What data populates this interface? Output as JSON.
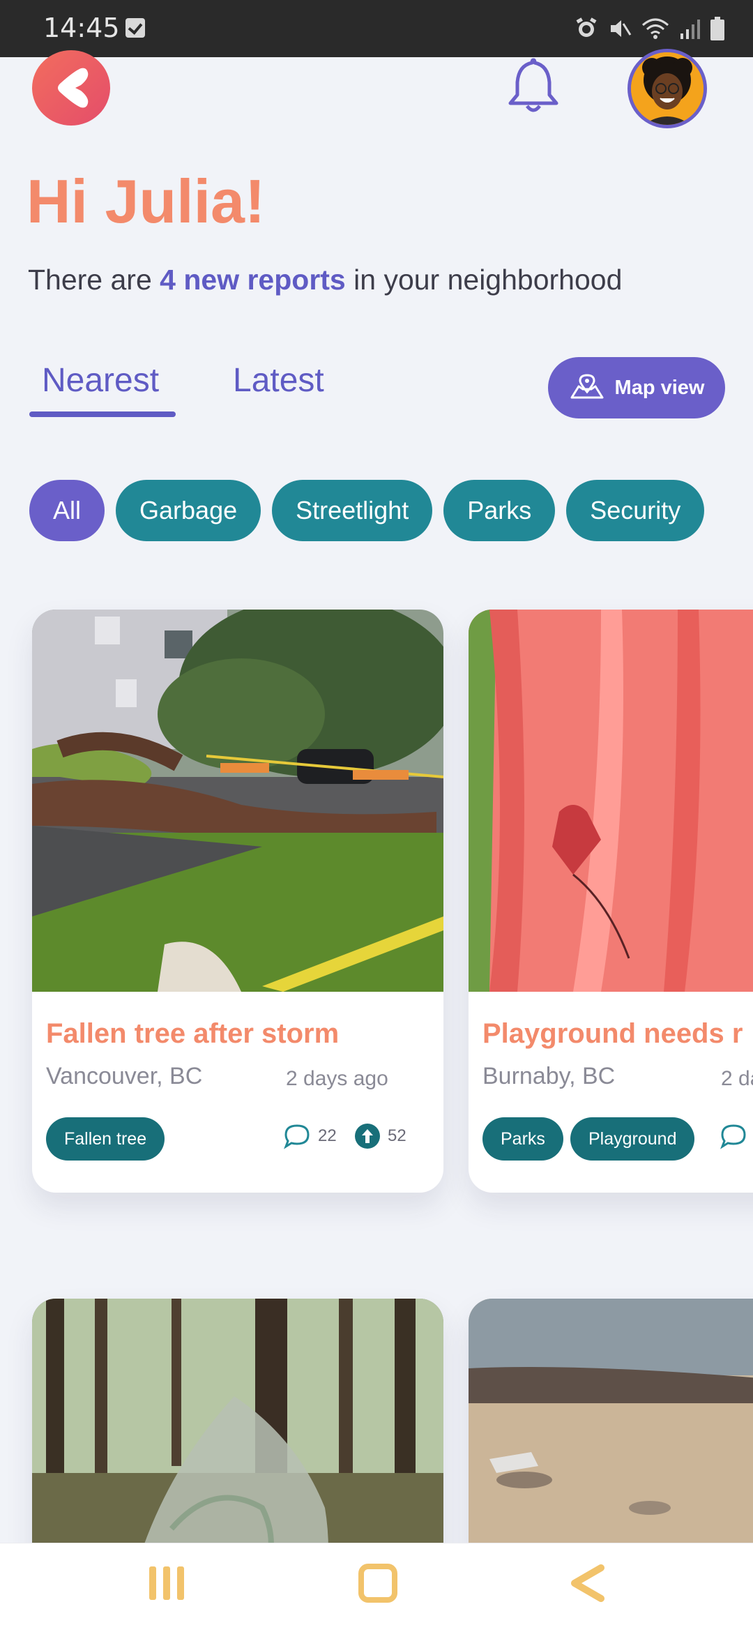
{
  "status_bar": {
    "time": "14:45"
  },
  "header": {
    "greeting": "Hi Julia!",
    "subline_prefix": "There are ",
    "subline_highlight": "4 new reports",
    "subline_suffix": " in your neighborhood"
  },
  "tabs": [
    {
      "label": "Nearest",
      "active": true
    },
    {
      "label": "Latest",
      "active": false
    }
  ],
  "map_button": {
    "label": "Map view"
  },
  "filters": [
    {
      "label": "All",
      "active": true
    },
    {
      "label": "Garbage",
      "active": false
    },
    {
      "label": "Streetlight",
      "active": false
    },
    {
      "label": "Parks",
      "active": false
    },
    {
      "label": "Security",
      "active": false
    }
  ],
  "reports": [
    {
      "title": "Fallen tree after storm",
      "location": "Vancouver, BC",
      "time": "2 days ago",
      "tags": [
        "Fallen tree"
      ],
      "comments": "22",
      "upvotes": "52"
    },
    {
      "title": "Playground needs r",
      "location": "Burnaby, BC",
      "time": "2 da",
      "tags": [
        "Parks",
        "Playground"
      ]
    }
  ],
  "colors": {
    "accent_purple": "#6a5fc9",
    "accent_coral": "#f38a6b",
    "teal": "#218896",
    "background": "#f1f3f8"
  },
  "icons": {
    "back": "back-chevron-icon",
    "notifications": "bell-icon",
    "map": "map-pin-icon",
    "comments": "comment-icon",
    "upvote": "upvote-icon",
    "nav_recent": "recent-apps-icon",
    "nav_home": "home-icon",
    "nav_back": "nav-back-icon"
  }
}
